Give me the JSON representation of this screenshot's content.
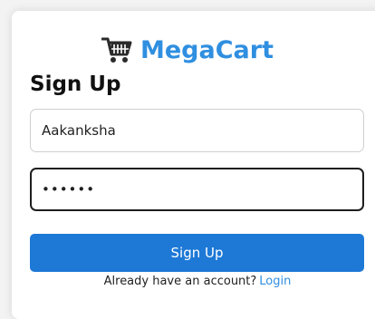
{
  "brand": {
    "name": "MegaCart",
    "icon": "shopping-cart-icon",
    "color": "#2f8fe0"
  },
  "form": {
    "title": "Sign Up",
    "username_value": "Aakanksha",
    "password_value": "••••••",
    "submit_label": "Sign Up"
  },
  "footer": {
    "prompt": "Already have an account?",
    "login_label": "Login"
  },
  "colors": {
    "button": "#1d78d6",
    "link": "#2f8fe0"
  }
}
